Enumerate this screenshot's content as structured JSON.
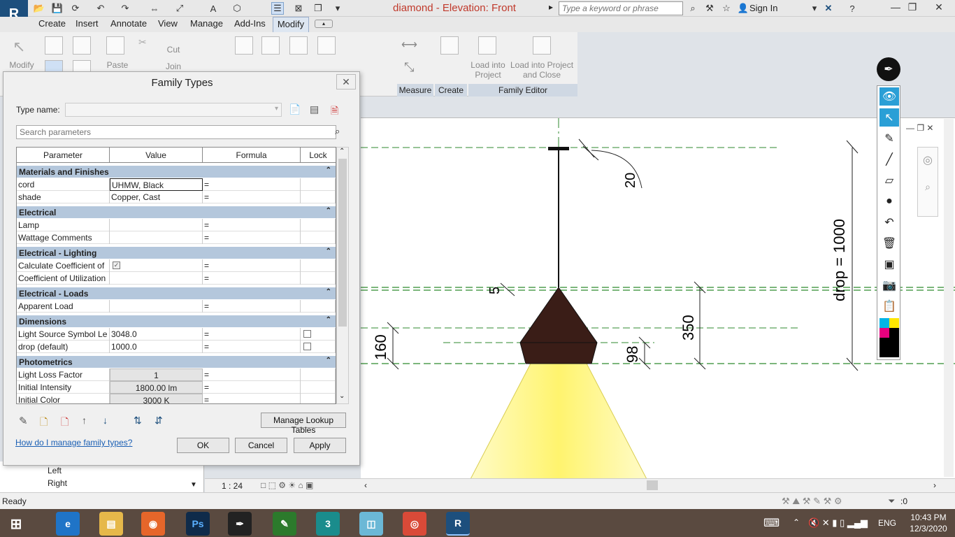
{
  "window": {
    "title": "diamond - Elevation: Front",
    "app_icon": "R"
  },
  "search": {
    "placeholder": "Type a keyword or phrase"
  },
  "account": {
    "sign_in": "Sign In"
  },
  "tabs": [
    "Create",
    "Insert",
    "Annotate",
    "View",
    "Manage",
    "Add-Ins",
    "Modify"
  ],
  "ribbon": {
    "modify": "Modify",
    "paste": "Paste",
    "cut": "Cut",
    "join": "Join",
    "load_into_project": "Load into Project",
    "load_into_project_close": "Load into Project and Close",
    "panels": {
      "measure": "Measure",
      "create": "Create",
      "family_editor": "Family Editor"
    }
  },
  "dialog": {
    "title": "Family Types",
    "type_name_label": "Type name:",
    "search_placeholder": "Search parameters",
    "columns": [
      "Parameter",
      "Value",
      "Formula",
      "Lock"
    ],
    "groups": [
      {
        "name": "Materials and Finishes",
        "rows": [
          {
            "param": "cord",
            "value": "UHMW, Black",
            "formula": "="
          },
          {
            "param": "shade",
            "value": "Copper, Cast",
            "formula": "="
          }
        ]
      },
      {
        "name": "Electrical",
        "rows": [
          {
            "param": "Lamp",
            "value": "",
            "formula": "="
          },
          {
            "param": "Wattage Comments",
            "value": "",
            "formula": "="
          }
        ]
      },
      {
        "name": "Electrical - Lighting",
        "rows": [
          {
            "param": "Calculate Coefficient of",
            "value": "",
            "formula": "="
          },
          {
            "param": "Coefficient of Utilization",
            "value": "",
            "formula": "="
          }
        ]
      },
      {
        "name": "Electrical - Loads",
        "rows": [
          {
            "param": "Apparent Load",
            "value": "",
            "formula": "="
          }
        ]
      },
      {
        "name": "Dimensions",
        "rows": [
          {
            "param": "Light Source Symbol Le",
            "value": "3048.0",
            "formula": "="
          },
          {
            "param": "drop (default)",
            "value": "1000.0",
            "formula": "="
          }
        ]
      },
      {
        "name": "Photometrics",
        "rows": [
          {
            "param": "Light Loss Factor",
            "value": "1",
            "formula": "="
          },
          {
            "param": "Initial Intensity",
            "value": "1800.00 lm",
            "formula": "="
          },
          {
            "param": "Initial Color",
            "value": "3000 K",
            "formula": "="
          }
        ]
      }
    ],
    "manage_lookup": "Manage Lookup Tables",
    "help_link": "How do I manage family types?",
    "ok": "OK",
    "cancel": "Cancel",
    "apply": "Apply"
  },
  "browser": {
    "items": [
      "Left",
      "Right"
    ]
  },
  "view": {
    "scale": "1 : 24"
  },
  "drawing": {
    "dim_20": "20",
    "dim_5": "5",
    "dim_drop": "drop = 1000",
    "dim_350": "350",
    "dim_160": "160",
    "dim_98": "98"
  },
  "status": {
    "text": "Ready",
    "filter_count": ":0"
  },
  "tray": {
    "lang": "ENG",
    "time": "10:43 PM",
    "date": "12/3/2020"
  },
  "colors": {
    "accent": "#1d4f7d",
    "group_header": "#b4c7dc",
    "title_red": "#c0392b",
    "shade": "#3a1d17",
    "light": "#fff9b0"
  }
}
